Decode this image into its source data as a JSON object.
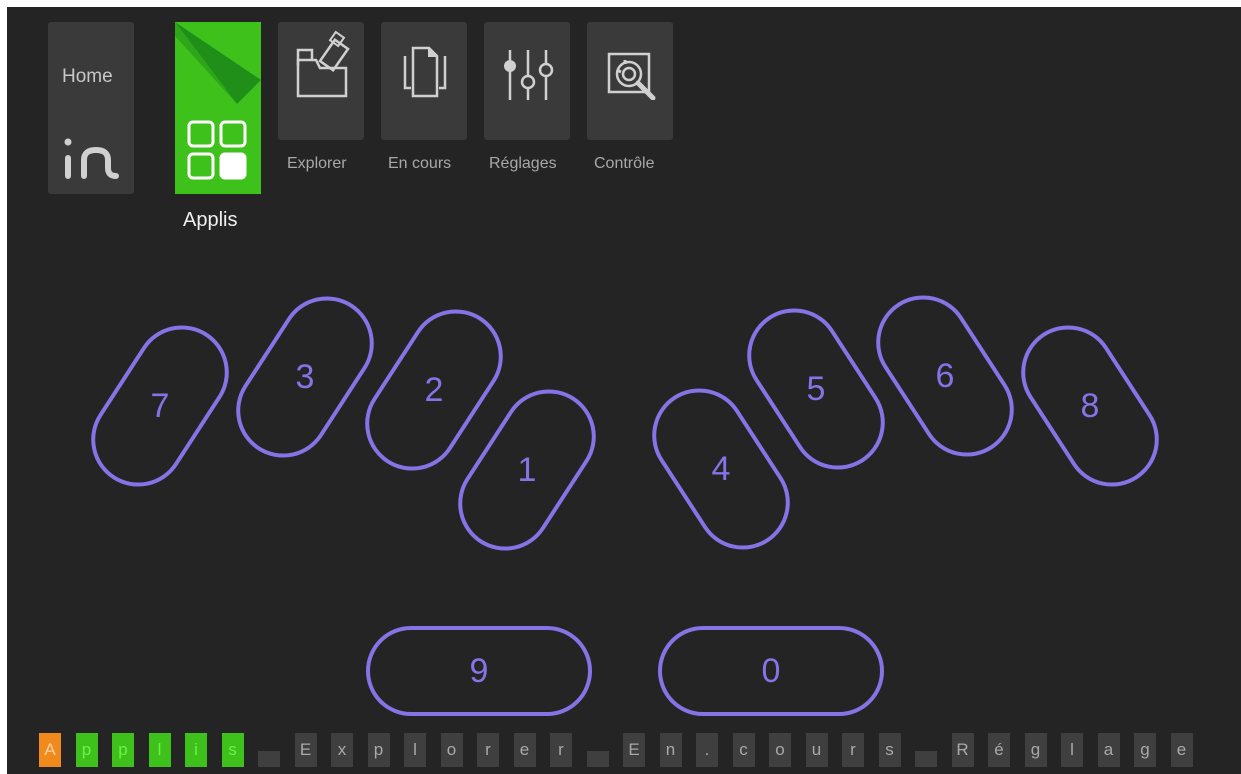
{
  "nav": {
    "home_label": "Home",
    "apps_label": "Applis",
    "tiles": [
      {
        "label": "Explorer",
        "icon": "folder-usb-icon"
      },
      {
        "label": "En cours",
        "icon": "documents-icon"
      },
      {
        "label": "Réglages",
        "icon": "sliders-icon"
      },
      {
        "label": "Contrôle",
        "icon": "gear-magnifier-icon"
      }
    ]
  },
  "keys": [
    "7",
    "3",
    "2",
    "1",
    "4",
    "5",
    "6",
    "8",
    "9",
    "0"
  ],
  "braille_line": [
    "A",
    "p",
    "p",
    "l",
    "i",
    "s",
    " ",
    "E",
    "x",
    "p",
    "l",
    "o",
    "r",
    "e",
    "r",
    " ",
    "E",
    "n",
    ".",
    "c",
    "o",
    "u",
    "r",
    "s",
    " ",
    "R",
    "é",
    "g",
    "l",
    "a",
    "g",
    "e"
  ],
  "colors": {
    "background": "#242424",
    "accent_green": "#3fc11b",
    "key_purple": "#8673e6",
    "cursor_orange": "#f08a1c"
  }
}
